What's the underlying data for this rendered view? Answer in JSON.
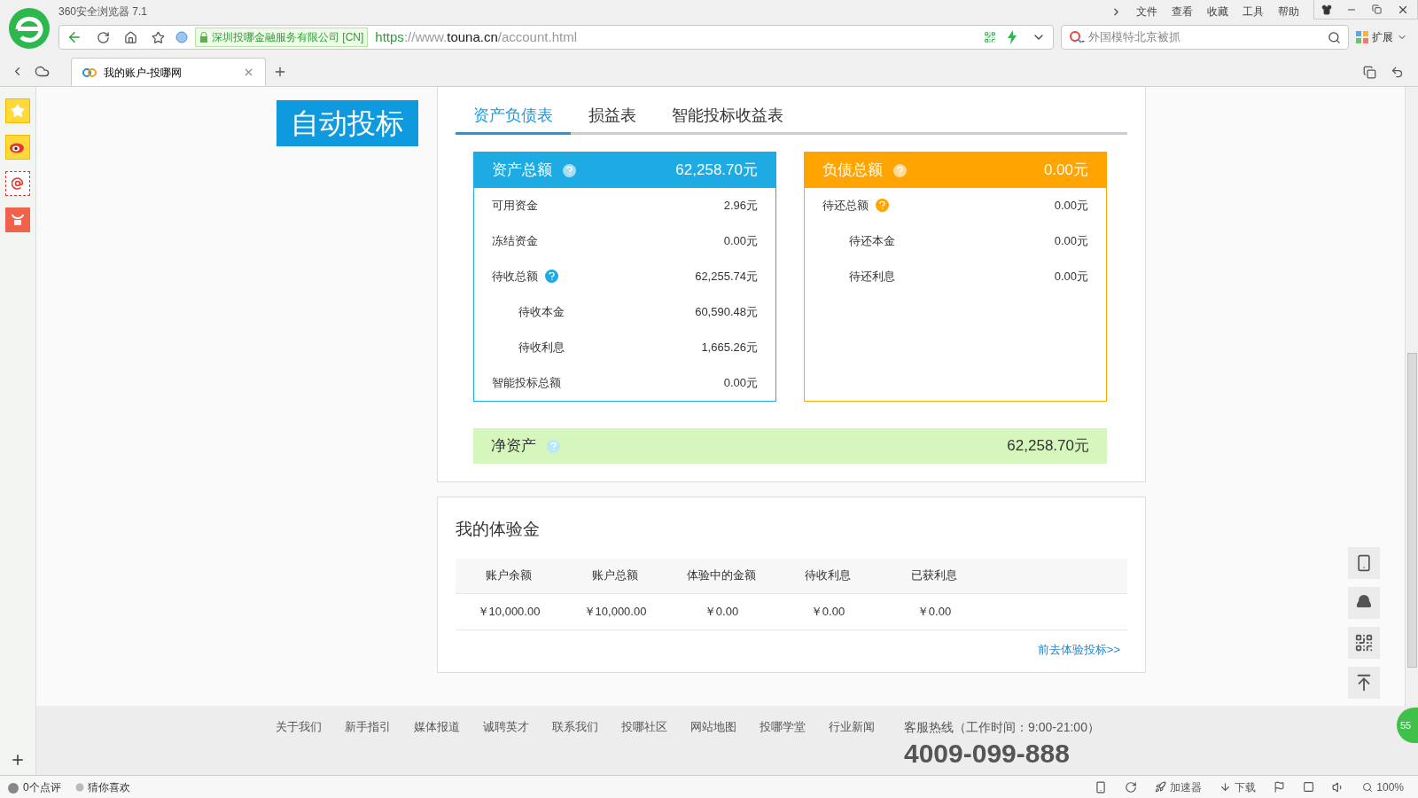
{
  "browser": {
    "title": "360安全浏览器 7.1",
    "menu": [
      "文件",
      "查看",
      "收藏",
      "工具",
      "帮助"
    ],
    "cert": "深圳投哪金融服务有限公司 [CN]",
    "url": {
      "scheme": "https",
      "sep": "://www.",
      "host": "touna.cn",
      "path": "/account.html"
    },
    "search_placeholder": "外国模特北京被抓",
    "extensions": "扩展",
    "tabs": [
      {
        "label": "我的账户-投哪网",
        "selected": true
      }
    ]
  },
  "sidebar_banner": "自动投标",
  "tabs": [
    {
      "label": "资产负债表",
      "selected": true
    },
    {
      "label": "损益表",
      "selected": false
    },
    {
      "label": "智能投标收益表",
      "selected": false
    }
  ],
  "assets": {
    "title": "资产总额",
    "total": "62,258.70元",
    "rows": [
      {
        "label": "可用资金",
        "value": "2.96元",
        "indent": false,
        "help": false
      },
      {
        "label": "冻结资金",
        "value": "0.00元",
        "indent": false,
        "help": false
      },
      {
        "label": "待收总额",
        "value": "62,255.74元",
        "indent": false,
        "help": true
      },
      {
        "label": "待收本金",
        "value": "60,590.48元",
        "indent": true,
        "help": false
      },
      {
        "label": "待收利息",
        "value": "1,665.26元",
        "indent": true,
        "help": false
      },
      {
        "label": "智能投标总额",
        "value": "0.00元",
        "indent": false,
        "help": false
      }
    ]
  },
  "liabilities": {
    "title": "负债总额",
    "total": "0.00元",
    "rows": [
      {
        "label": "待还总额",
        "value": "0.00元",
        "indent": false,
        "help": true
      },
      {
        "label": "待还本金",
        "value": "0.00元",
        "indent": true,
        "help": false
      },
      {
        "label": "待还利息",
        "value": "0.00元",
        "indent": true,
        "help": false
      }
    ]
  },
  "net_assets": {
    "label": "净资产",
    "value": "62,258.70元"
  },
  "trial": {
    "title": "我的体验金",
    "columns": [
      "账户余额",
      "账户总额",
      "体验中的金额",
      "待收利息",
      "已获利息"
    ],
    "rows": [
      [
        "￥10,000.00",
        "￥10,000.00",
        "￥0.00",
        "￥0.00",
        "￥0.00"
      ]
    ],
    "link": "前去体验投标>>"
  },
  "footer": {
    "links": [
      "关于我们",
      "新手指引",
      "媒体报道",
      "诚聘英才",
      "联系我们",
      "投哪社区",
      "网站地图",
      "投哪学堂",
      "行业新闻"
    ],
    "hotline": "客服热线（工作时间：9:00-21:00）",
    "phone": "4009-099-888"
  },
  "float_badge": "55",
  "status_bar": {
    "reviews": "0个点评",
    "guess": "猜你喜欢",
    "accelerator": "加速器",
    "download": "下载",
    "zoom": "100%"
  }
}
